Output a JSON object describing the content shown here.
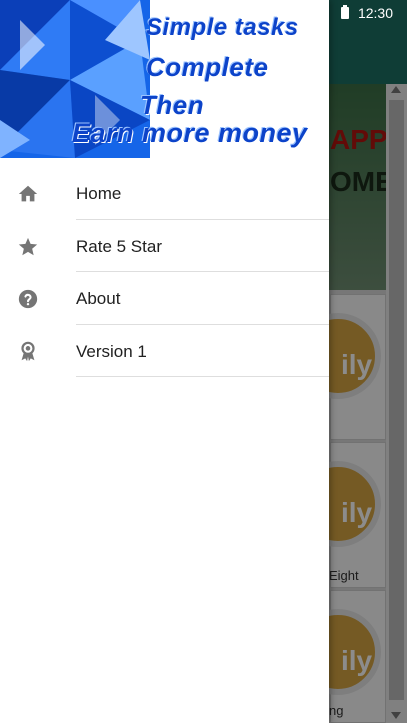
{
  "status_bar": {
    "time": "12:30"
  },
  "drawer": {
    "header": {
      "lines": [
        "Simple tasks",
        "Complete",
        "Then",
        "Earn more money"
      ]
    },
    "menu": [
      {
        "label": "Home",
        "icon": "home-icon"
      },
      {
        "label": "Rate 5 Star",
        "icon": "star-icon"
      },
      {
        "label": "About",
        "icon": "help-circle-icon"
      },
      {
        "label": "Version 1",
        "icon": "award-ribbon-icon"
      }
    ]
  },
  "background": {
    "banner_text_1": "APP",
    "banner_text_2": "OME",
    "cards": [
      {
        "coin_text": "ily",
        "label": ""
      },
      {
        "coin_text": "ily",
        "label": "Eight"
      },
      {
        "coin_text": "ily",
        "label": "ng"
      }
    ]
  },
  "colors": {
    "header_text": "#0c43c9",
    "appbar": "#1c6f63",
    "coin": "#d6a442"
  }
}
